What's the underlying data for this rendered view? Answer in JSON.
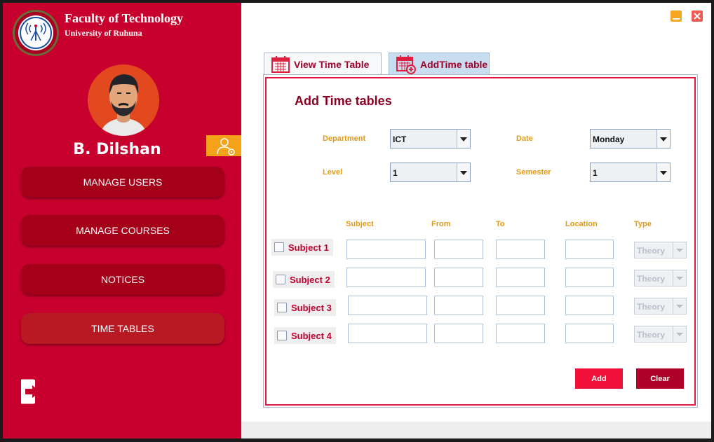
{
  "org": {
    "title": "Faculty of Technology",
    "subtitle": "University of Ruhuna"
  },
  "user": {
    "name": "B. Dilshan"
  },
  "nav": [
    {
      "label": "MANAGE USERS"
    },
    {
      "label": "MANAGE COURSES"
    },
    {
      "label": "NOTICES"
    },
    {
      "label": "TIME TABLES"
    }
  ],
  "tabs": [
    {
      "label": "View Time Table"
    },
    {
      "label": "AddTime table"
    }
  ],
  "form": {
    "title": "Add Time tables",
    "department": {
      "label": "Department",
      "value": "ICT"
    },
    "date": {
      "label": "Date",
      "value": "Monday"
    },
    "level": {
      "label": "Level",
      "value": "1"
    },
    "semester": {
      "label": "Semester",
      "value": "1"
    },
    "columns": [
      "Subject",
      "From",
      "To",
      "Location",
      "Type"
    ],
    "rows": [
      {
        "label": "Subject 1",
        "type": "Theory"
      },
      {
        "label": "Subject 2",
        "type": "Theory"
      },
      {
        "label": "Subject 3",
        "type": "Theory"
      },
      {
        "label": "Subject 4",
        "type": "Theory"
      }
    ],
    "add_label": "Add",
    "clear_label": "Clear"
  },
  "colors": {
    "sidebar": "#c8002e",
    "nav_button": "#a4001a",
    "accent_label": "#e39a17",
    "title": "#8a0022"
  }
}
